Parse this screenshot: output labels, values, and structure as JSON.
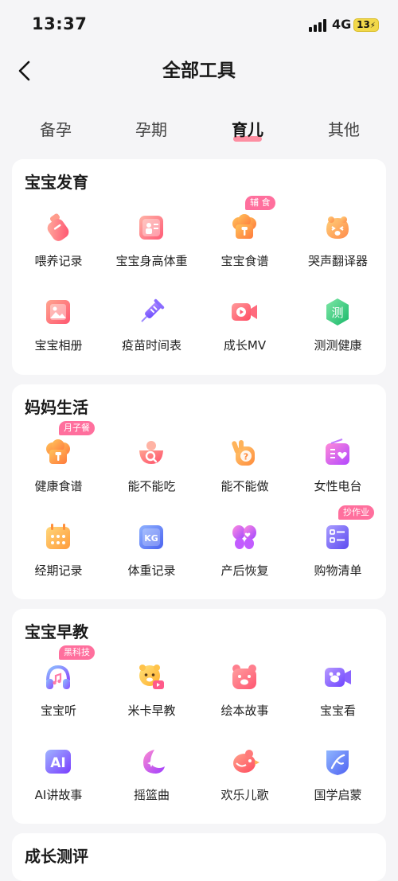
{
  "status_bar": {
    "time": "13:37",
    "network": "4G",
    "battery": "13"
  },
  "header": {
    "title": "全部工具"
  },
  "tabs": [
    {
      "label": "备孕"
    },
    {
      "label": "孕期"
    },
    {
      "label": "育儿",
      "active": true
    },
    {
      "label": "其他"
    }
  ],
  "sections": [
    {
      "title": "宝宝发育",
      "items": [
        {
          "label": "喂养记录",
          "icon": "baby-bottle-icon"
        },
        {
          "label": "宝宝身高体重",
          "icon": "height-weight-card-icon"
        },
        {
          "label": "宝宝食谱",
          "icon": "chef-hat-icon",
          "badge": "辅 食"
        },
        {
          "label": "哭声翻译器",
          "icon": "crying-face-icon"
        },
        {
          "label": "宝宝相册",
          "icon": "photo-album-icon"
        },
        {
          "label": "疫苗时间表",
          "icon": "vaccine-syringe-icon"
        },
        {
          "label": "成长MV",
          "icon": "video-camera-icon"
        },
        {
          "label": "测测健康",
          "icon": "health-test-badge-icon",
          "icon_text": "测"
        }
      ]
    },
    {
      "title": "妈妈生活",
      "items": [
        {
          "label": "健康食谱",
          "icon": "chef-hat-icon",
          "badge": "月子餐"
        },
        {
          "label": "能不能吃",
          "icon": "food-bowl-search-icon"
        },
        {
          "label": "能不能做",
          "icon": "hand-question-icon"
        },
        {
          "label": "女性电台",
          "icon": "radio-heart-icon"
        },
        {
          "label": "经期记录",
          "icon": "period-calendar-icon"
        },
        {
          "label": "体重记录",
          "icon": "weight-scale-icon",
          "icon_text": "KG"
        },
        {
          "label": "产后恢复",
          "icon": "butterfly-heart-icon"
        },
        {
          "label": "购物清单",
          "icon": "shopping-checklist-icon",
          "badge": "抄作业"
        }
      ]
    },
    {
      "title": "宝宝早教",
      "items": [
        {
          "label": "宝宝听",
          "icon": "headphones-icon",
          "badge": "黑科技"
        },
        {
          "label": "米卡早教",
          "icon": "tiger-video-icon"
        },
        {
          "label": "绘本故事",
          "icon": "bear-book-icon"
        },
        {
          "label": "宝宝看",
          "icon": "bear-video-camera-icon"
        },
        {
          "label": "AI讲故事",
          "icon": "ai-story-icon",
          "icon_text": "AI"
        },
        {
          "label": "摇篮曲",
          "icon": "moon-star-icon"
        },
        {
          "label": "欢乐儿歌",
          "icon": "singing-bird-icon"
        },
        {
          "label": "国学启蒙",
          "icon": "chinese-classics-shield-icon"
        }
      ]
    },
    {
      "title": "成长测评",
      "items": []
    }
  ],
  "colors": {
    "accent": "#ff6b86",
    "badge": "#ff6f9d",
    "background": "#f5f5f7",
    "card": "#ffffff"
  }
}
